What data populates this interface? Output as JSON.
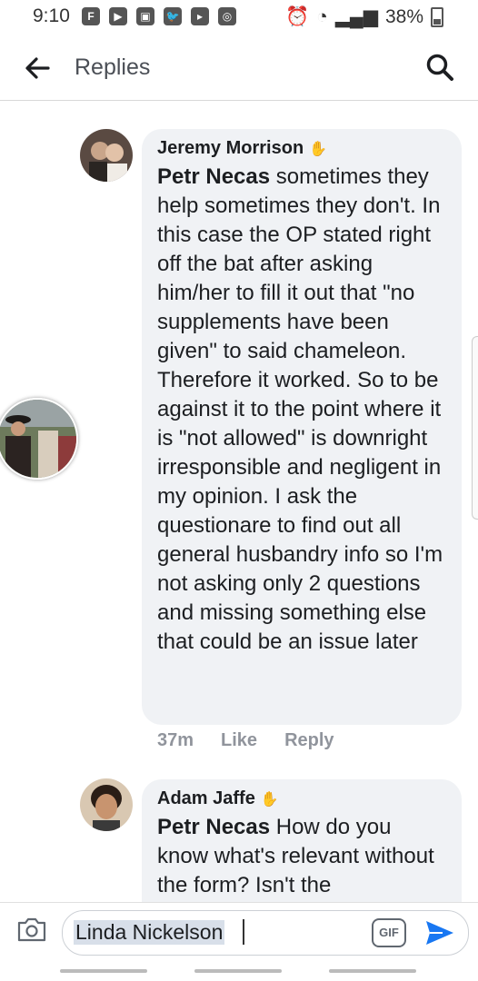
{
  "status_bar": {
    "time": "9:10",
    "battery": "38%",
    "notification_icons": [
      "F",
      "▶",
      "▣",
      "🐦",
      "▸",
      "◎"
    ]
  },
  "header": {
    "title": "Replies"
  },
  "comments": [
    {
      "author": "Jeremy Morrison",
      "mention": "Petr Necas",
      "text": " sometimes they help sometimes they don't. In this case the OP stated right off the bat after asking him/her to fill it out that \"no supplements have been given\" to said chameleon. Therefore it worked. So to be against it to the point where it is \"not allowed\" is downright irresponsible and negligent in my opinion. I ask the questionare to find out all general husbandry info so I'm not asking only 2 questions and missing something else that could be an issue later",
      "time": "37m",
      "like_label": "Like",
      "reply_label": "Reply"
    },
    {
      "author": "Adam Jaffe",
      "mention": "Petr Necas",
      "text": " How do you know what's relevant without the form?  Isn't the"
    }
  ],
  "composer": {
    "input_value": "Linda Nickelson",
    "gif_label": "GIF"
  },
  "colors": {
    "bubble": "#f0f2f5",
    "send_blue": "#1877f2",
    "meta_gray": "#90949c"
  }
}
